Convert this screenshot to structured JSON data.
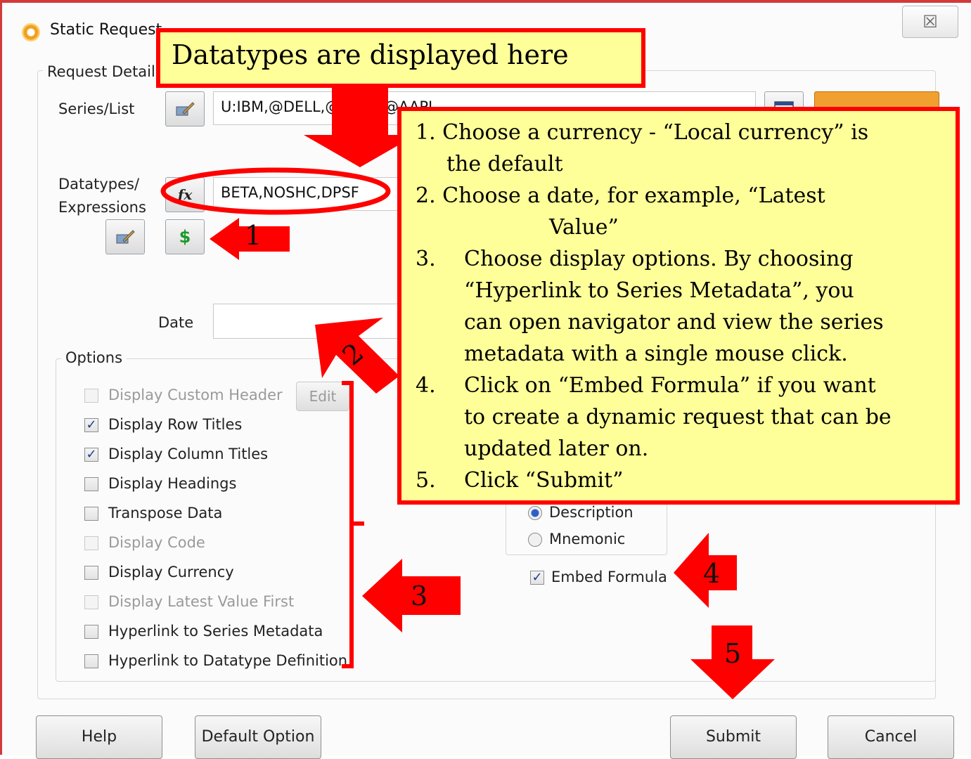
{
  "window": {
    "title": "Static Request",
    "close_glyph": "☒"
  },
  "request_details": {
    "group_label": "Request Detail",
    "series_label": "Series/List",
    "series_value": "U:IBM,@DELL,@MSFT,@AAPL",
    "datatypes_label_line1": "Datatypes/",
    "datatypes_label_line2": "Expressions",
    "fx_glyph": "fx",
    "datatypes_value": "BETA,NOSHC,DPSF",
    "currency_glyph": "$",
    "date_label": "Date",
    "date_value": ""
  },
  "options": {
    "group_label": "Options",
    "edit_button": "Edit",
    "items": [
      {
        "label": "Display Custom Header",
        "checked": false,
        "disabled": true
      },
      {
        "label": "Display Row Titles",
        "checked": true,
        "disabled": false
      },
      {
        "label": "Display Column Titles",
        "checked": true,
        "disabled": false
      },
      {
        "label": "Display Headings",
        "checked": false,
        "disabled": false
      },
      {
        "label": "Transpose Data",
        "checked": false,
        "disabled": false
      },
      {
        "label": "Display Code",
        "checked": false,
        "disabled": true
      },
      {
        "label": "Display Currency",
        "checked": false,
        "disabled": false
      },
      {
        "label": "Display Latest Value First",
        "checked": false,
        "disabled": true
      },
      {
        "label": "Hyperlink to Series Metadata",
        "checked": false,
        "disabled": false
      },
      {
        "label": "Hyperlink to Datatype Definition",
        "checked": false,
        "disabled": false
      }
    ],
    "radio_description": "Description",
    "radio_mnemonic": "Mnemonic",
    "radio_selected": "Description",
    "embed_formula": "Embed Formula",
    "embed_checked": true
  },
  "buttons": {
    "help": "Help",
    "default_option": "Default Option",
    "submit": "Submit",
    "cancel": "Cancel"
  },
  "annotations": {
    "title_callout": "Datatypes are displayed here",
    "steps": [
      "1. Choose a currency -    “Local currency” is",
      "the default",
      "2.  Choose a date, for example, “Latest",
      "Value”",
      "3.",
      "Choose display options. By choosing",
      "“Hyperlink to Series Metadata”, you",
      "can open navigator and view the series",
      "metadata with a single mouse click.",
      "4.",
      "Click on “Embed Formula” if you want",
      "to create a dynamic request that can be",
      "updated later on.",
      "5.",
      "Click “Submit”"
    ],
    "arrow_labels": [
      "1",
      "2",
      "3",
      "4",
      "5"
    ]
  },
  "colors": {
    "callout_fill": "#ffff99",
    "callout_border": "#ff0000",
    "arrow_red": "#ff0000",
    "find_button_orange": "#f0a030"
  }
}
